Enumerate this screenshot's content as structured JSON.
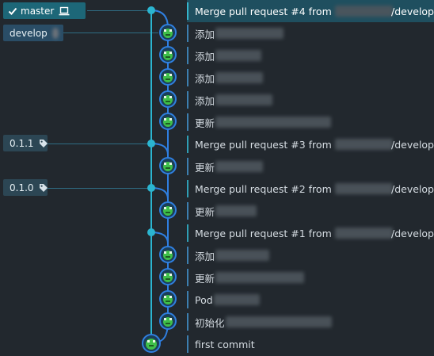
{
  "refs": {
    "master": {
      "label": "master",
      "icon": "laptop-icon",
      "check": "check-icon"
    },
    "develop": {
      "label": "develop"
    },
    "tags": [
      {
        "label": "0.1.1",
        "icon": "tag-icon"
      },
      {
        "label": "0.1.0",
        "icon": "tag-icon"
      }
    ]
  },
  "commits": [
    {
      "text": "Merge pull request #4 from",
      "suffix": "/develop",
      "type": "merge",
      "head": true
    },
    {
      "text": "添加",
      "suffix": "",
      "type": "commit"
    },
    {
      "text": "添加",
      "suffix": "",
      "type": "commit"
    },
    {
      "text": "添加",
      "suffix": "",
      "type": "commit"
    },
    {
      "text": "添加",
      "suffix": "",
      "type": "commit"
    },
    {
      "text": "更新",
      "suffix": "",
      "type": "commit"
    },
    {
      "text": "Merge pull request #3 from",
      "suffix": "/develop",
      "type": "merge"
    },
    {
      "text": "更新",
      "suffix": "",
      "type": "commit"
    },
    {
      "text": "Merge pull request #2 from",
      "suffix": "/develop",
      "type": "merge"
    },
    {
      "text": "更新",
      "suffix": "",
      "type": "commit"
    },
    {
      "text": "Merge pull request #1 from",
      "suffix": "/develop",
      "type": "merge"
    },
    {
      "text": "添加",
      "suffix": "",
      "type": "commit"
    },
    {
      "text": "更新",
      "suffix": "",
      "type": "commit"
    },
    {
      "text": "Pod",
      "suffix": "",
      "type": "commit"
    },
    {
      "text": "初始化",
      "suffix": "",
      "type": "commit"
    },
    {
      "text": "first commit",
      "suffix": "",
      "type": "root"
    }
  ],
  "colors": {
    "master_lane": "#2bb5d0",
    "develop_lane": "#2f7fe0",
    "avatar_face": "#3fbf4a"
  }
}
